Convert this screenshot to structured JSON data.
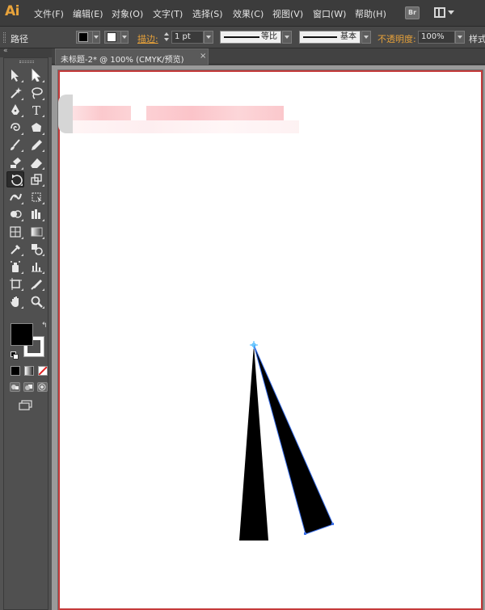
{
  "app": {
    "logo": "Ai"
  },
  "menu": [
    "文件(F)",
    "编辑(E)",
    "对象(O)",
    "文字(T)",
    "选择(S)",
    "效果(C)",
    "视图(V)",
    "窗口(W)",
    "帮助(H)"
  ],
  "menubar_buttons": {
    "bridge": "Br"
  },
  "control_bar": {
    "selection_label": "路径",
    "stroke_label": "描边:",
    "stroke_weight": "1 pt",
    "variable_width_profile": "等比",
    "brush_definition": "基本",
    "opacity_label": "不透明度:",
    "opacity_value": "100%",
    "style_label": "样式"
  },
  "colors": {
    "fill": "#000000",
    "stroke": "#ffffff",
    "accent_orange": "#e6a13a",
    "artboard_border": "#c53a3a",
    "selection_blue": "#3a6fe8"
  },
  "document_tab": {
    "title": "未标题-2* @ 100% (CMYK/预览)",
    "close": "×"
  },
  "toolbox": {
    "tools": [
      "selection-tool",
      "direct-selection-tool",
      "magic-wand-tool",
      "lasso-tool",
      "pen-tool",
      "type-tool",
      "spiral-tool",
      "polygon-tool",
      "paintbrush-tool",
      "pencil-tool",
      "blob-brush-tool",
      "eraser-tool",
      "rotate-tool",
      "scale-tool",
      "width-tool",
      "free-transform-tool",
      "shape-builder-tool",
      "chart-tool",
      "mesh-tool",
      "gradient-tool",
      "eyedropper-tool",
      "blend-tool",
      "symbol-sprayer-tool",
      "column-graph-tool",
      "artboard-tool",
      "slice-tool",
      "hand-tool",
      "zoom-tool"
    ],
    "active_tool": "rotate-tool"
  }
}
